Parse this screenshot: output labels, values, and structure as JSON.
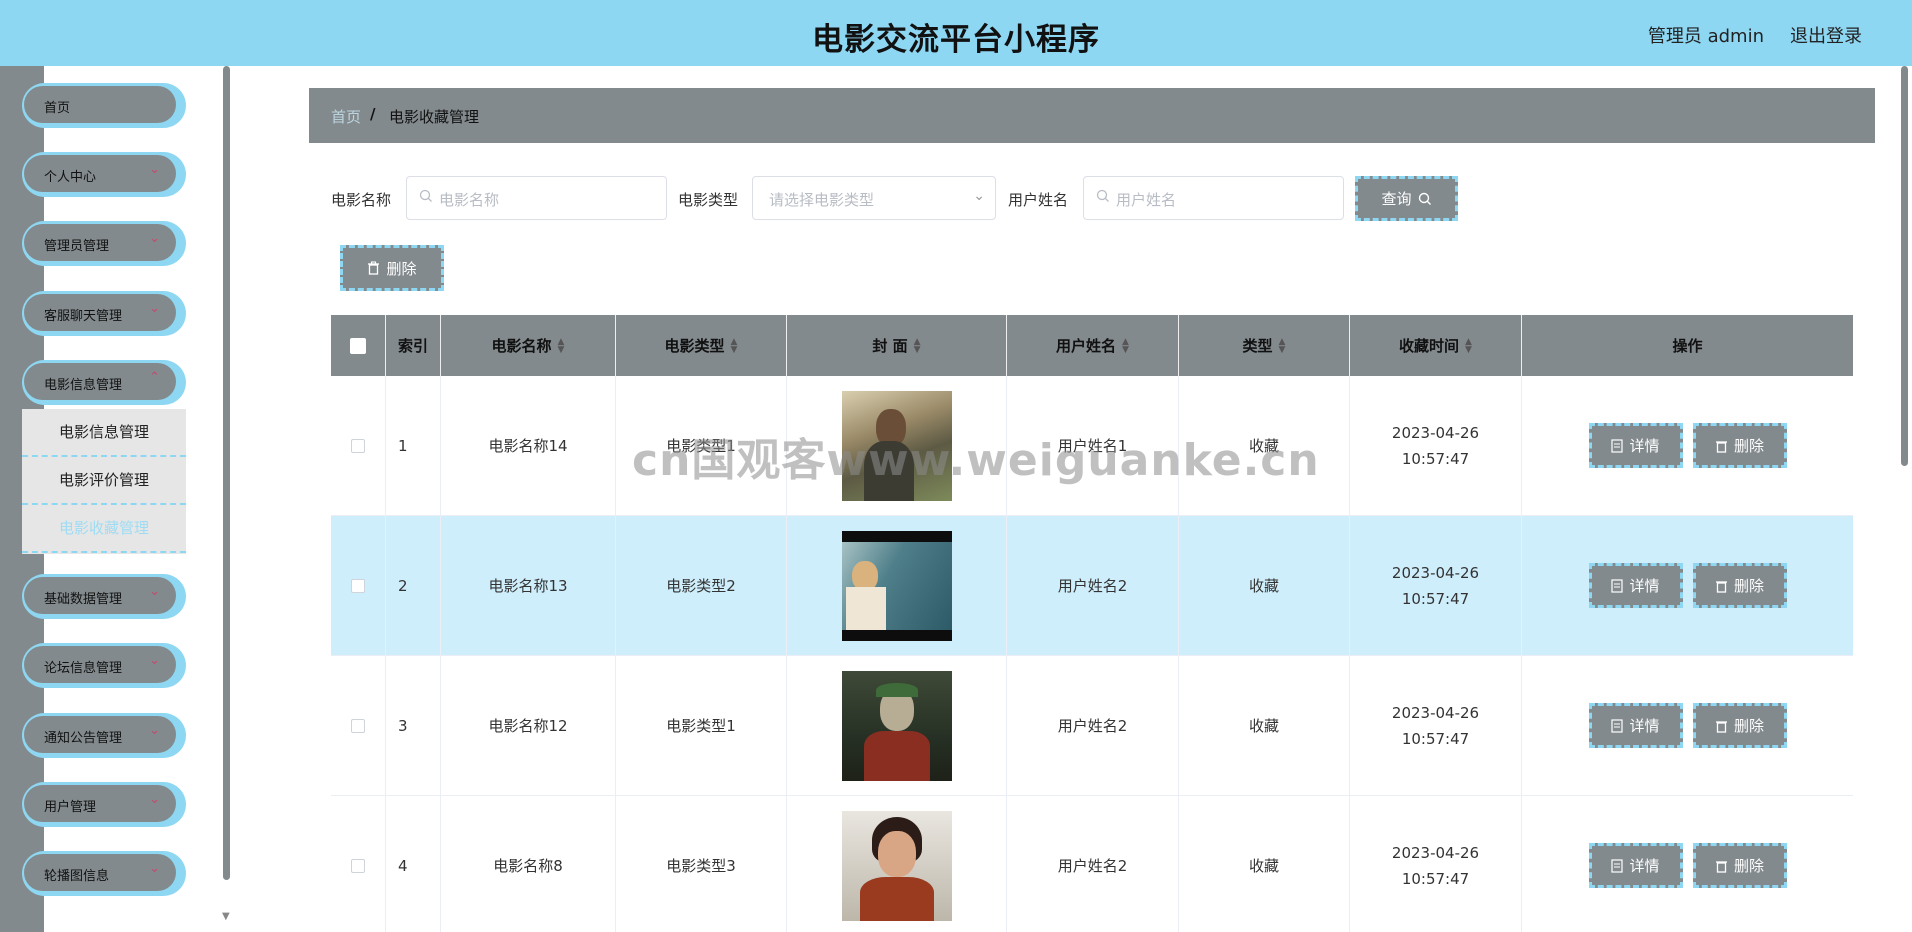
{
  "header": {
    "title": "电影交流平台小程序",
    "user": "管理员 admin",
    "logout": "退出登录"
  },
  "sidebar": {
    "items": [
      {
        "label": "首页"
      },
      {
        "label": "个人中心"
      },
      {
        "label": "管理员管理"
      },
      {
        "label": "客服聊天管理"
      },
      {
        "label": "电影信息管理"
      },
      {
        "label": "基础数据管理"
      },
      {
        "label": "论坛信息管理"
      },
      {
        "label": "通知公告管理"
      },
      {
        "label": "用户管理"
      },
      {
        "label": "轮播图信息"
      }
    ],
    "submenu": [
      {
        "label": "电影信息管理"
      },
      {
        "label": "电影评价管理"
      },
      {
        "label": "电影收藏管理"
      }
    ]
  },
  "breadcrumb": {
    "home": "首页",
    "separator": "/",
    "current": "电影收藏管理"
  },
  "filters": {
    "movie_name_label": "电影名称",
    "movie_name_placeholder": "电影名称",
    "movie_type_label": "电影类型",
    "movie_type_placeholder": "请选择电影类型",
    "user_name_label": "用户姓名",
    "user_name_placeholder": "用户姓名",
    "query_label": "查询"
  },
  "toolbar": {
    "delete_label": "删除"
  },
  "table": {
    "headers": [
      "索引",
      "电影名称",
      "电影类型",
      "封 面",
      "用户姓名",
      "类型",
      "收藏时间",
      "操作"
    ],
    "rows": [
      {
        "index": "1",
        "name": "电影名称14",
        "type": "电影类型1",
        "user": "用户姓名1",
        "kind": "收藏",
        "time": "2023-04-26 10:57:47"
      },
      {
        "index": "2",
        "name": "电影名称13",
        "type": "电影类型2",
        "user": "用户姓名2",
        "kind": "收藏",
        "time": "2023-04-26 10:57:47"
      },
      {
        "index": "3",
        "name": "电影名称12",
        "type": "电影类型1",
        "user": "用户姓名2",
        "kind": "收藏",
        "time": "2023-04-26 10:57:47"
      },
      {
        "index": "4",
        "name": "电影名称8",
        "type": "电影类型3",
        "user": "用户姓名2",
        "kind": "收藏",
        "time": "2023-04-26 10:57:47"
      }
    ],
    "detail_label": "详情",
    "delete_label": "删除"
  },
  "watermark": "cn国观客www.weiguanke.cn",
  "colors": {
    "header_bg": "#8ed7f3",
    "sidebar_pill": "#838a8d",
    "highlight_row": "#cfeefb"
  }
}
